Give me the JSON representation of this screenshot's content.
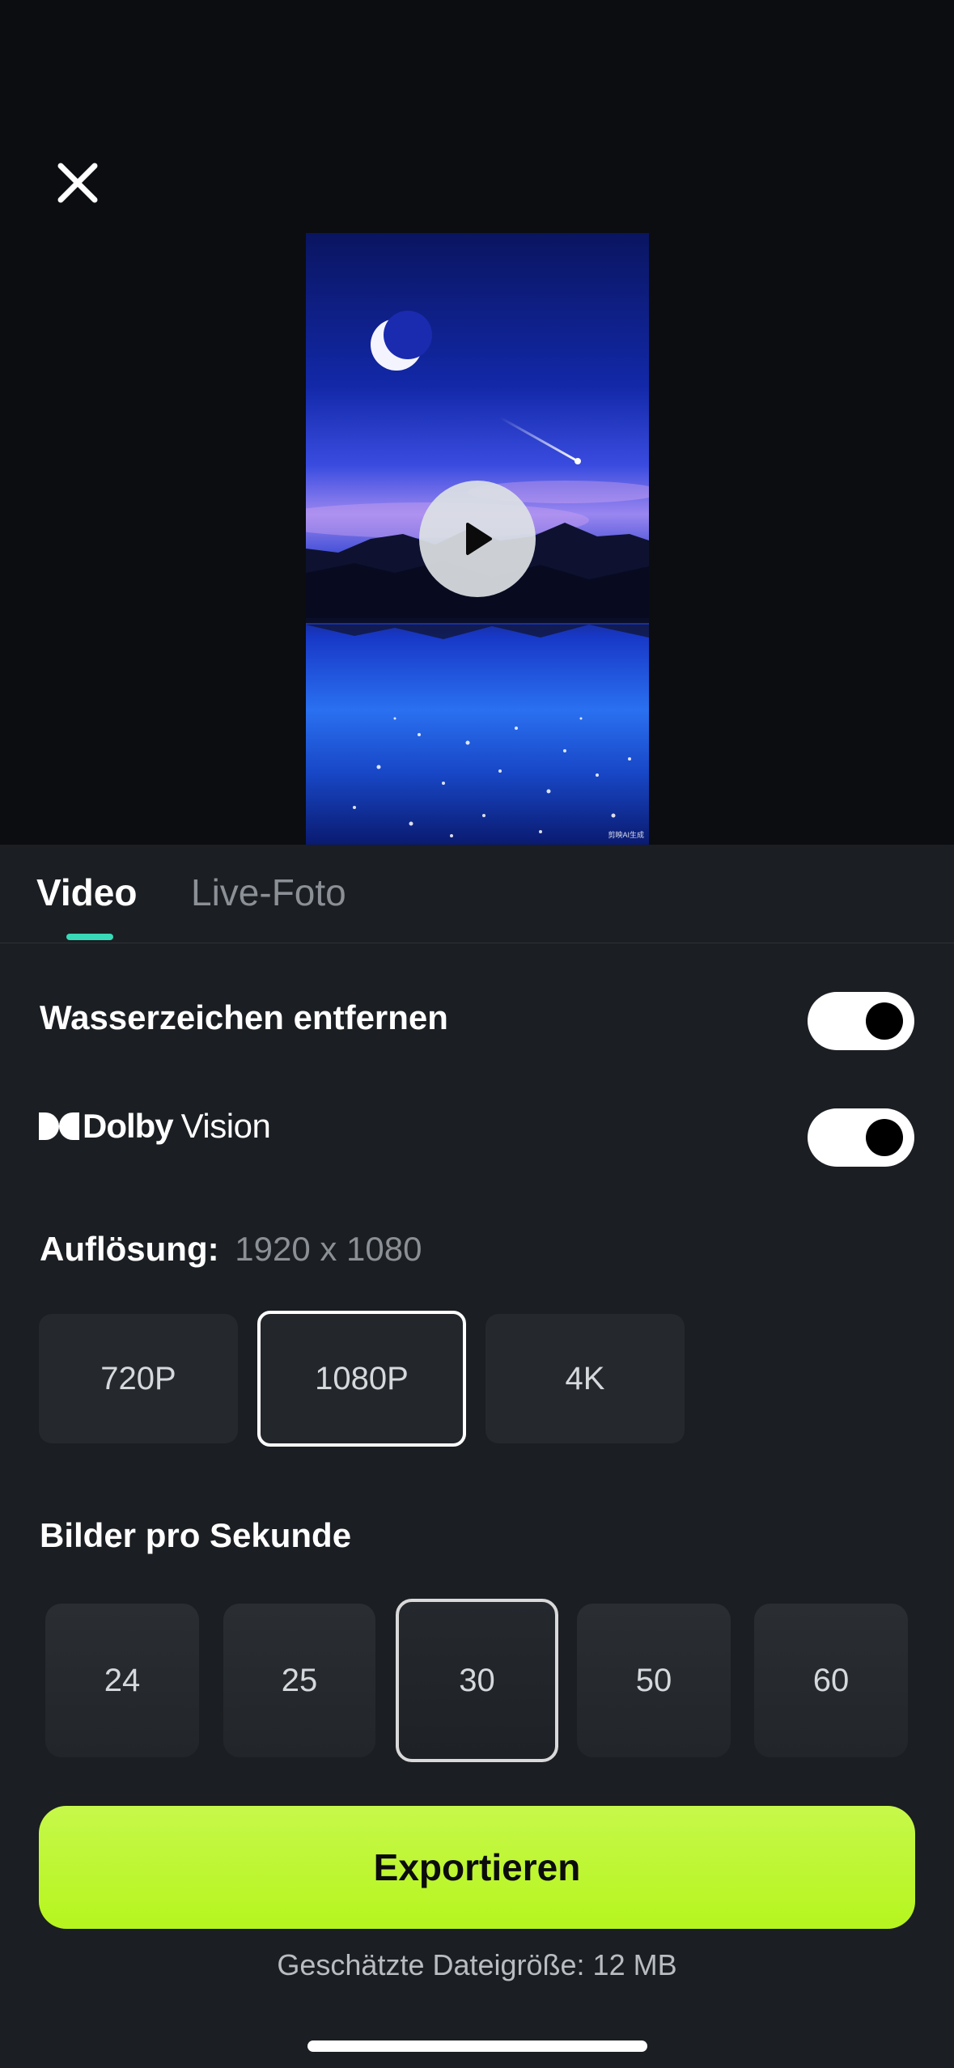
{
  "header": {
    "close_icon": "close-icon"
  },
  "preview": {
    "play_icon": "play-icon",
    "watermark_text": "剪映AI生成"
  },
  "tabs": [
    {
      "label": "Video",
      "active": true
    },
    {
      "label": "Live-Foto",
      "active": false
    }
  ],
  "settings": {
    "remove_watermark": {
      "label": "Wasserzeichen entfernen",
      "enabled": true
    },
    "dolby_vision": {
      "brand": "Dolby",
      "label": "Vision",
      "enabled": true
    },
    "resolution": {
      "label": "Auflösung:",
      "value": "1920 x 1080",
      "options": [
        "720P",
        "1080P",
        "4K"
      ],
      "selected": "1080P"
    },
    "fps": {
      "label": "Bilder pro Sekunde",
      "options": [
        "24",
        "25",
        "30",
        "50",
        "60"
      ],
      "selected": "30"
    }
  },
  "export": {
    "button_label": "Exportieren",
    "filesize_text": "Geschätzte Dateigröße: 12 MB"
  },
  "colors": {
    "accent": "#38d9b8",
    "export_button": "#bef637",
    "sheet_background": "#1b1e22",
    "top_background": "#0b0d10"
  }
}
